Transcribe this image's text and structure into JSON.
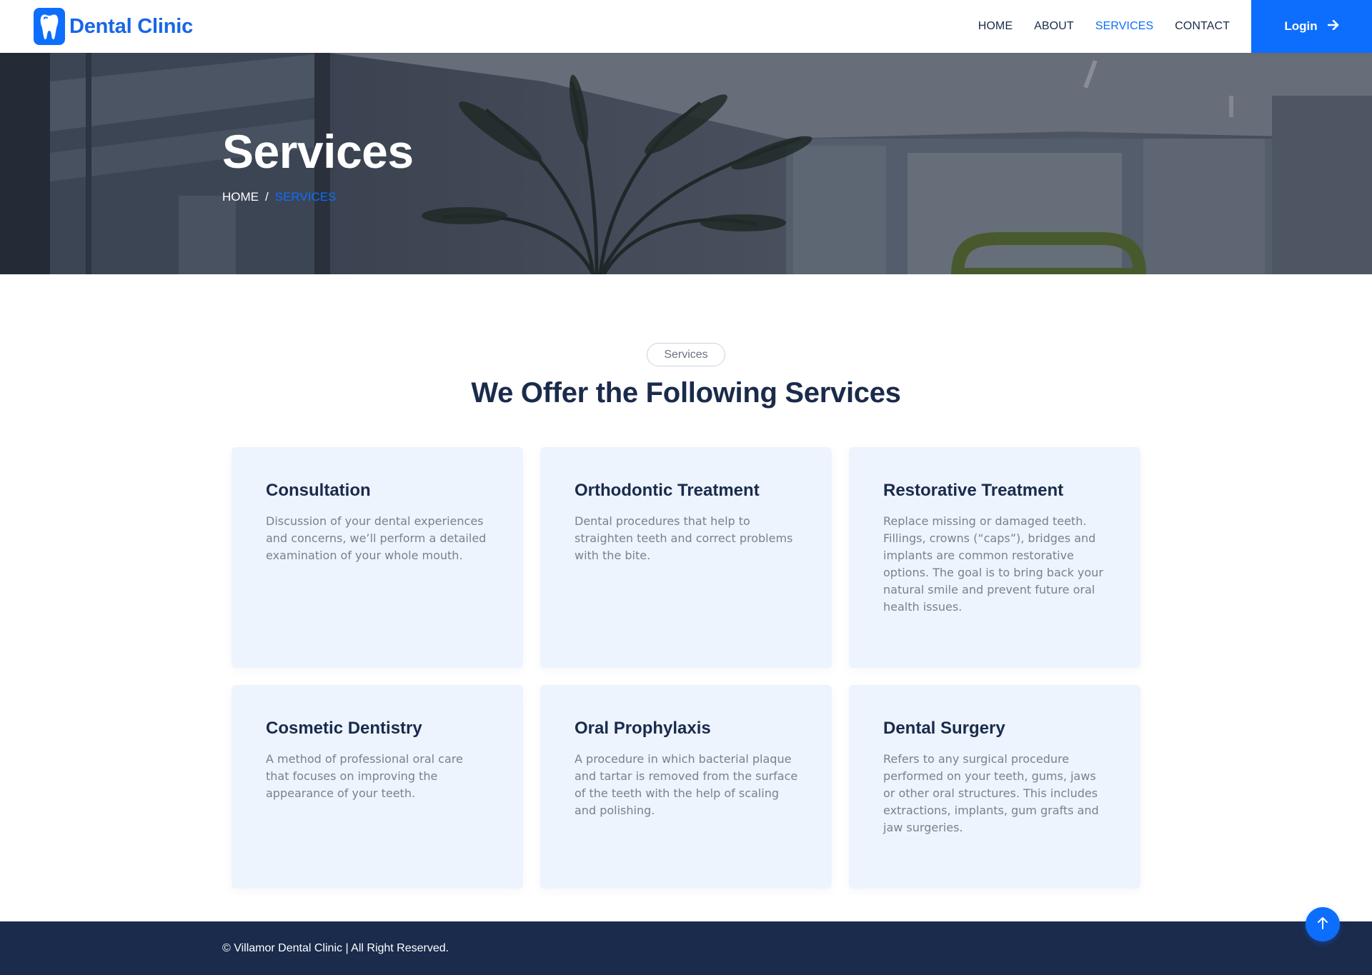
{
  "brand": {
    "name": "Dental Clinic",
    "logo_icon": "tooth-icon"
  },
  "nav": {
    "items": [
      {
        "label": "HOME",
        "active": false
      },
      {
        "label": "ABOUT",
        "active": false
      },
      {
        "label": "SERVICES",
        "active": true
      },
      {
        "label": "CONTACT",
        "active": false
      }
    ],
    "login_label": "Login",
    "login_icon": "arrow-right-icon"
  },
  "hero": {
    "title": "Services",
    "breadcrumb": {
      "home": "HOME",
      "separator": "/",
      "current": "SERVICES"
    }
  },
  "section": {
    "badge": "Services",
    "title": "We Offer the Following Services",
    "cards": [
      {
        "title": "Consultation",
        "description": "Discussion of your dental experiences and concerns, we’ll perform a detailed examination of your whole mouth."
      },
      {
        "title": "Orthodontic Treatment",
        "description": "Dental procedures that help to straighten teeth and correct problems with the bite."
      },
      {
        "title": "Restorative Treatment",
        "description": "Replace missing or damaged teeth. Fillings, crowns (“caps”), bridges and implants are common restorative options. The goal is to bring back your natural smile and prevent future oral health issues."
      },
      {
        "title": "Cosmetic Dentistry",
        "description": "A method of professional oral care that focuses on improving the appearance of your teeth."
      },
      {
        "title": "Oral Prophylaxis",
        "description": "A procedure in which bacterial plaque and tartar is removed from the surface of the teeth with the help of scaling and polishing."
      },
      {
        "title": "Dental Surgery",
        "description": "Refers to any surgical procedure performed on your teeth, gums, jaws or other oral structures. This includes extractions, implants, gum grafts and jaw surgeries."
      }
    ]
  },
  "footer": {
    "text": "© Villamor Dental Clinic | All Right Reserved."
  },
  "back_to_top_icon": "arrow-up-icon",
  "colors": {
    "primary": "#0d6efd",
    "navy": "#1a2b4b",
    "card_bg": "#edf4fe"
  }
}
